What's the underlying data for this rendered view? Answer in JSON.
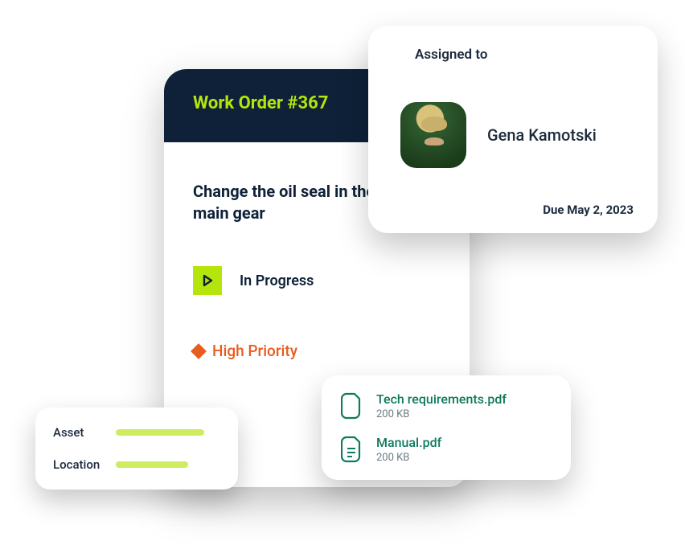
{
  "workOrder": {
    "title": "Work Order #367",
    "task": "Change the oil seal in the main gear",
    "status": "In Progress",
    "priority": "High Priority"
  },
  "assigned": {
    "label": "Assigned to",
    "name": "Gena Kamotski",
    "due": "Due May 2, 2023"
  },
  "attachments": [
    {
      "name": "Tech requirements.pdf",
      "size": "200 KB"
    },
    {
      "name": "Manual.pdf",
      "size": "200 KB"
    }
  ],
  "meta": {
    "assetLabel": "Asset",
    "locationLabel": "Location"
  }
}
